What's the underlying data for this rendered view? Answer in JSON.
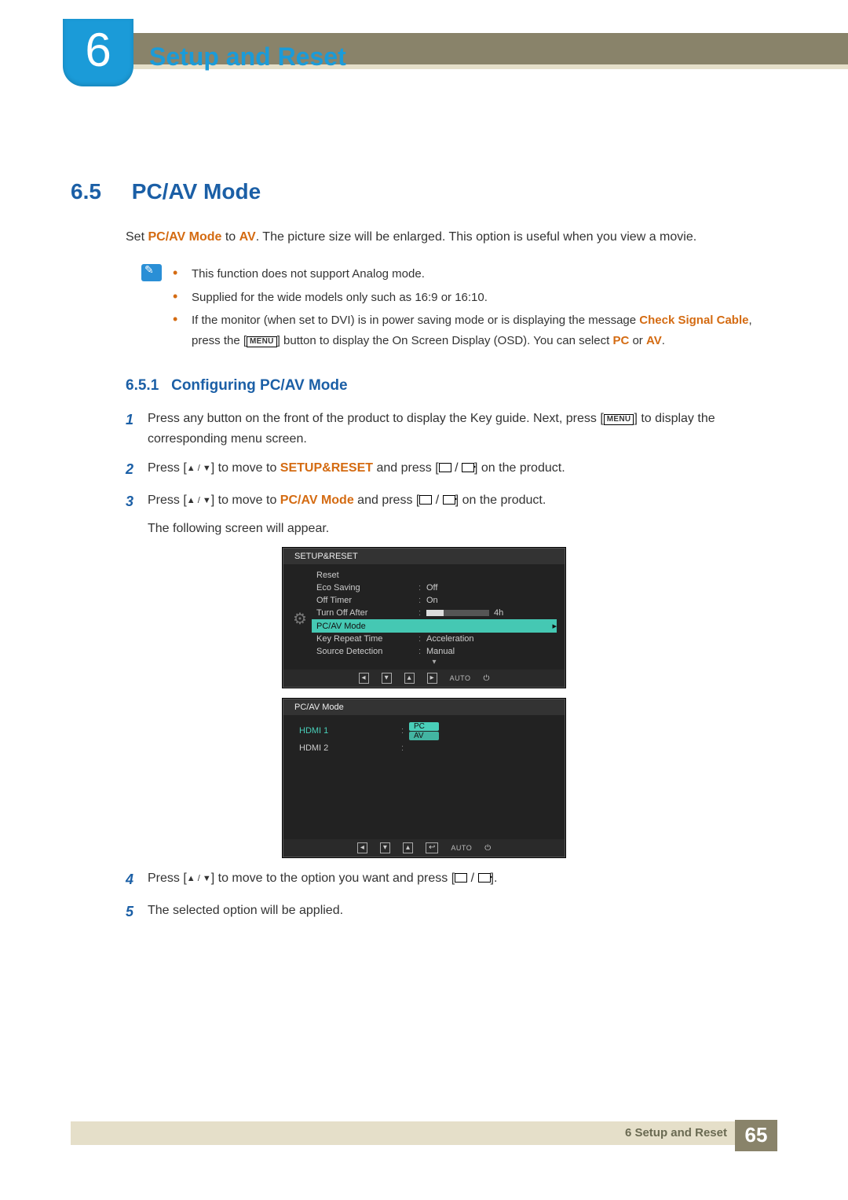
{
  "header": {
    "chapter_number": "6",
    "chapter_title": "Setup and Reset"
  },
  "section": {
    "number": "6.5",
    "title": "PC/AV Mode",
    "intro_pre": "Set ",
    "intro_term": "PC/AV Mode",
    "intro_mid": " to ",
    "intro_val": "AV",
    "intro_post": ". The picture size will be enlarged. This option is useful when you view a movie.",
    "notes": [
      "This function does not support Analog mode.",
      "Supplied for the wide models only such as 16:9 or 16:10.",
      "If the monitor (when set to DVI) is in power saving mode or is displaying the message Check Signal Cable, press the [MENU] button to display the On Screen Display (OSD). You can select PC or AV."
    ],
    "note3_term1": "Check Signal Cable",
    "note3_menu": "MENU",
    "note3_term2": "PC",
    "note3_term3": "AV"
  },
  "subsection": {
    "number": "6.5.1",
    "title": "Configuring PC/AV Mode",
    "steps": {
      "s1_a": "Press any button on the front of the product to display the Key guide. Next, press [",
      "s1_menu": "MENU",
      "s1_b": "] to display the corresponding menu screen.",
      "s2_a": "Press [",
      "s2_b": "] to move to ",
      "s2_target": "SETUP&RESET",
      "s2_c": " and press [",
      "s2_d": "] on the product.",
      "s3_a": "Press [",
      "s3_b": "] to move to ",
      "s3_target": "PC/AV Mode",
      "s3_c": " and press [",
      "s3_d": "] on the product.",
      "s3_note": "The following screen will appear.",
      "s4_a": "Press [",
      "s4_b": "] to move to the option you want and press [",
      "s4_c": "].",
      "s5": "The selected option will be applied."
    }
  },
  "osd1": {
    "title": "SETUP&RESET",
    "rows": [
      {
        "label": "Reset",
        "val": ""
      },
      {
        "label": "Eco Saving",
        "val": "Off"
      },
      {
        "label": "Off Timer",
        "val": "On"
      },
      {
        "label": "Turn Off After",
        "val": "4h",
        "bar": true
      },
      {
        "label": "PC/AV Mode",
        "val": "",
        "hl": true
      },
      {
        "label": "Key Repeat Time",
        "val": "Acceleration"
      },
      {
        "label": "Source Detection",
        "val": "Manual"
      }
    ],
    "footer_auto": "AUTO"
  },
  "osd2": {
    "title": "PC/AV Mode",
    "rows": [
      {
        "label": "HDMI 1",
        "pill1": "PC",
        "pill2": "AV",
        "active": true
      },
      {
        "label": "HDMI 2"
      }
    ],
    "footer_auto": "AUTO"
  },
  "footer": {
    "label": "6 Setup and Reset",
    "page": "65"
  }
}
